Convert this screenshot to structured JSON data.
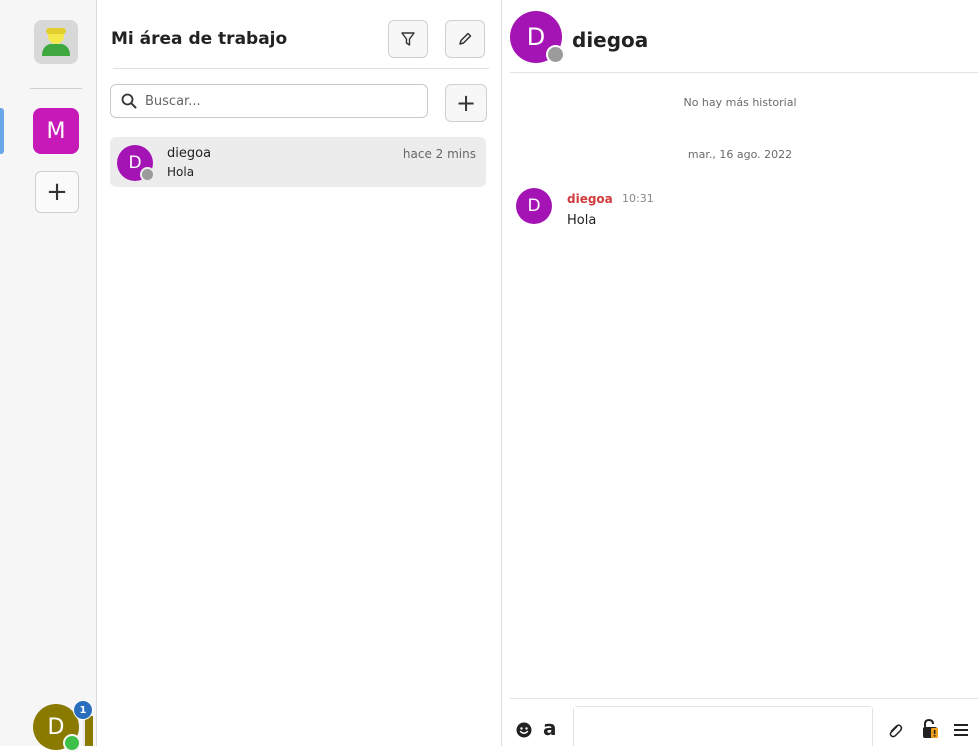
{
  "workspace_rail": {
    "active_workspace_letter": "M",
    "add_workspace_label": "+",
    "user_letter": "D",
    "notification_count": "1"
  },
  "room_list": {
    "title": "Mi área de trabajo",
    "search_placeholder": "Buscar...",
    "add_room_label": "+",
    "rooms": [
      {
        "avatar_letter": "D",
        "name": "diegoa",
        "preview": "Hola",
        "time": "hace 2 mins"
      }
    ]
  },
  "chat": {
    "contact_letter": "D",
    "contact_name": "diegoa",
    "no_history_text": "No hay más historial",
    "date_separator": "mar., 16 ago. 2022",
    "messages": [
      {
        "avatar_letter": "D",
        "sender": "diegoa",
        "time": "10:31",
        "text": "Hola"
      }
    ],
    "format_button_label": "a"
  },
  "colors": {
    "workspace_accent": "#c619b8",
    "contact_avatar": "#a414b4",
    "user_avatar": "#8a7a00",
    "sender_name": "#d23b3b",
    "badge": "#2a6ebd",
    "online": "#3ec14a",
    "offline": "#9b9b9b"
  }
}
